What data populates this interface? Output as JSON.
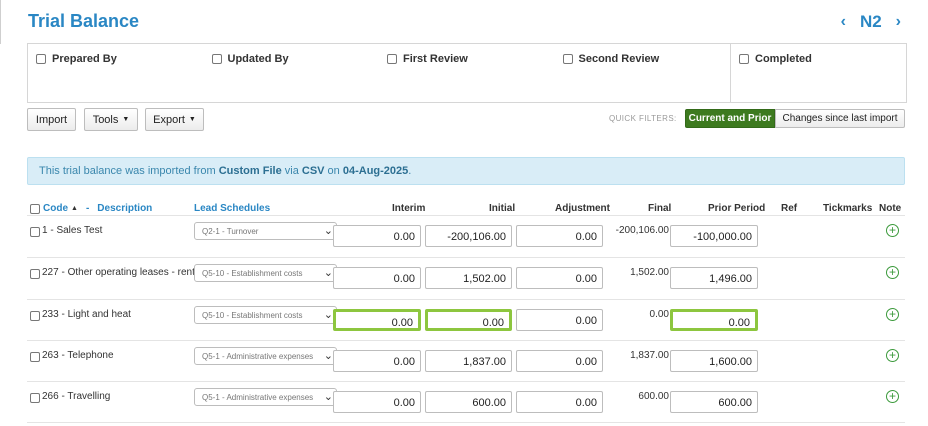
{
  "page": {
    "title": "Trial Balance",
    "nav_code": "N2"
  },
  "signoffs": [
    {
      "label": "Prepared By"
    },
    {
      "label": "Updated By"
    },
    {
      "label": "First Review"
    },
    {
      "label": "Second Review"
    },
    {
      "label": "Completed"
    }
  ],
  "toolbar": {
    "import_label": "Import",
    "tools_label": "Tools",
    "export_label": "Export",
    "quick_filters_label": "QUICK FILTERS:",
    "filter_active": "Current and Prior",
    "filter_other": "Changes since last import"
  },
  "info_banner": {
    "part1": "This trial balance was imported from ",
    "source": "Custom File",
    "part2": " via ",
    "format": "CSV",
    "part3": " on ",
    "date": "04-Aug-2025",
    "part4": "."
  },
  "table": {
    "headers": {
      "code": "Code",
      "sep": "-",
      "description": "Description",
      "lead": "Lead Schedules",
      "interim": "Interim",
      "initial": "Initial",
      "adjustment": "Adjustment",
      "final": "Final",
      "prior": "Prior Period",
      "ref": "Ref",
      "tickmarks": "Tickmarks",
      "note": "Note"
    },
    "rows": [
      {
        "label": "1 - Sales Test",
        "lead": "Q2-1 - Turnover",
        "interim": "0.00",
        "initial": "-200,106.00",
        "adjustment": "0.00",
        "final": "-200,106.00",
        "prior": "-100,000.00"
      },
      {
        "label": "227 - Other operating leases - rent",
        "lead": "Q5-10 - Establishment costs",
        "interim": "0.00",
        "initial": "1,502.00",
        "adjustment": "0.00",
        "final": "1,502.00",
        "prior": "1,496.00"
      },
      {
        "label": "233 - Light and heat",
        "lead": "Q5-10 - Establishment costs",
        "interim": "0.00",
        "initial": "0.00",
        "adjustment": "0.00",
        "final": "0.00",
        "prior": "0.00"
      },
      {
        "label": "263 - Telephone",
        "lead": "Q5-1 - Administrative expenses",
        "interim": "0.00",
        "initial": "1,837.00",
        "adjustment": "0.00",
        "final": "1,837.00",
        "prior": "1,600.00"
      },
      {
        "label": "266 - Travelling",
        "lead": "Q5-1 - Administrative expenses",
        "interim": "0.00",
        "initial": "600.00",
        "adjustment": "0.00",
        "final": "600.00",
        "prior": "600.00"
      }
    ]
  },
  "colors": {
    "accent": "#2a87c4",
    "filter_active": "#3d7a1f",
    "highlight": "#8dc63f",
    "info_bg": "#d9edf7"
  }
}
